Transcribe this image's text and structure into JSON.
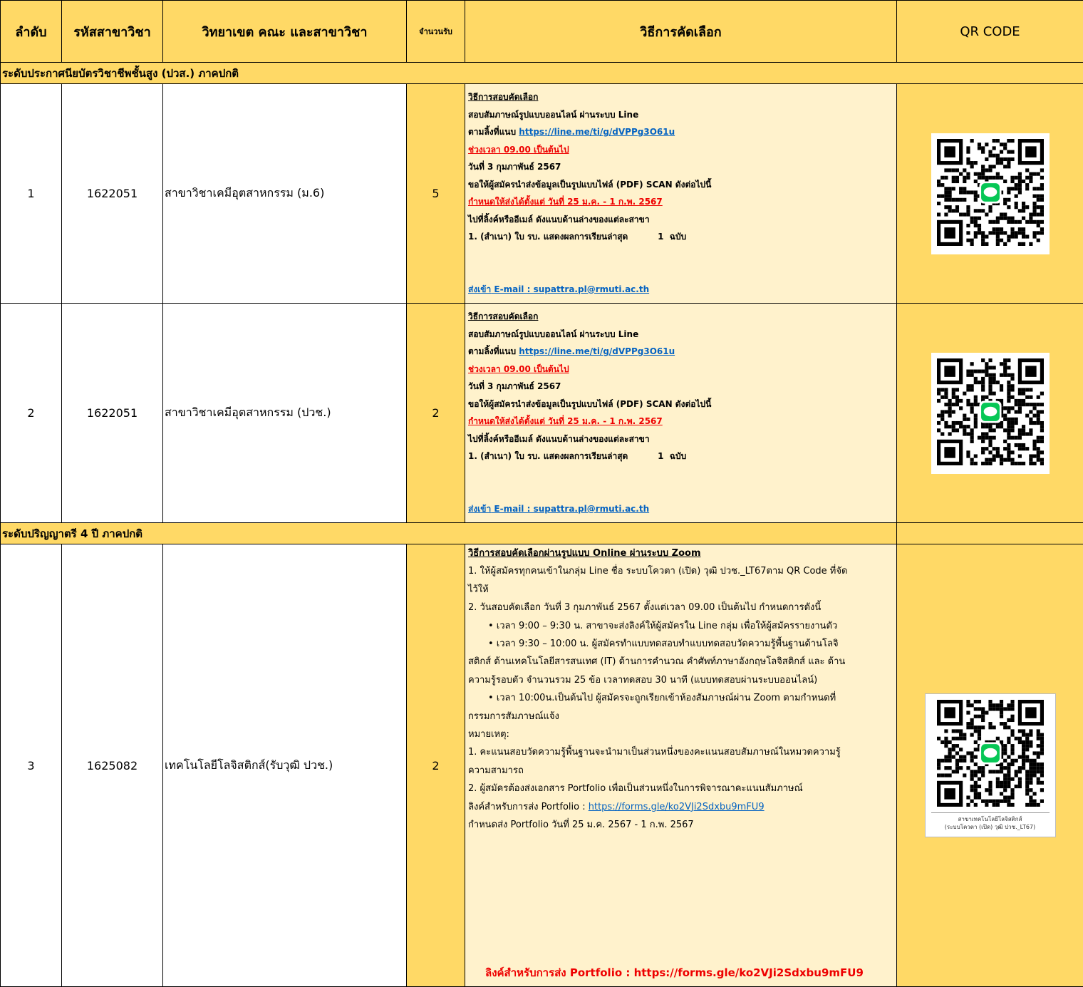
{
  "headers": {
    "order": "ลำดับ",
    "code": "รหัสสาขาวิชา",
    "faculty": "วิทยาเขต คณะ และสาขาวิชา",
    "seats": "จำนวนรับ",
    "method": "วิธีการคัดเลือก",
    "qr": "QR CODE"
  },
  "section1": "ระดับประกาศนียบัตรวิชาชีพชั้นสูง (ปวส.) ภาคปกติ",
  "section2": "ระดับปริญญาตรี 4 ปี ภาคปกติ",
  "rows": [
    {
      "order": "1",
      "code": "1622051",
      "name": "สาขาวิชาเคมีอุตสาหกรรม  (ม.6)",
      "seats": "5"
    },
    {
      "order": "2",
      "code": "1622051",
      "name": "สาขาวิชาเคมีอุตสาหกรรม  (ปวช.)",
      "seats": "2"
    },
    {
      "order": "3",
      "code": "1625082",
      "name": "เทคโนโลยีโลจิสติกส์(รับวุฒิ ปวช.)",
      "seats": "2"
    }
  ],
  "methodA": {
    "heading": "วิธีการสอบคัดเลือก",
    "l1": "สอบสัมภาษณ์รูปแบบออนไลน์ ผ่านระบบ Line",
    "l2prefix": "ตามลิ้งที่แนบ ",
    "link": "https://line.me/ti/g/dVPPg3O61u",
    "time": "ช่วงเวลา 09.00 เป็นต้นไป",
    "date": "วันที่ 3 กุมภาพันธ์ 2567",
    "submit": "ขอให้ผู้สมัครนำส่งข้อมูลเป็นรูปแบบไฟล์ (PDF) SCAN ดังต่อไปนี้",
    "deadline": "กำหนดให้ส่งได้ตั้งแต่ วันที่ 25 ม.ค. - 1 ก.พ. 2567",
    "go": "ไปที่ลิ้งค์หรืออีเมล์ ดังแนบด้านล่างของแต่ละสาขา",
    "doc": "1. (สำเนา) ใบ รบ. แสดงผลการเรียนล่าสุด          1  ฉบับ",
    "emailPrefix": "ส่งเข้า",
    "email": " E-mail : supattra.pl@rmuti.ac.th"
  },
  "methodB": {
    "heading": "วิธีการสอบคัดเลือกผ่านรูปแบบ Online ผ่านระบบ Zoom",
    "l1": "1. ให้ผู้สมัครทุกคนเข้าในกลุ่ม Line ชื่อ ระบบโควตา (เปิด) วุฒิ ปวช._LT67ตาม QR Code ที่จัด",
    "l1b": "ไว้ให้",
    "l2": "2. วันสอบคัดเลือก วันที่ 3 กุมภาพันธ์ 2567 ตั้งแต่เวลา 09.00 เป็นต้นไป กำหนดการดังนี้",
    "b1": "• เวลา 9:00 – 9:30 น. สาขาจะส่งลิงค์ให้ผู้สมัครใน Line กลุ่ม เพื่อให้ผู้สมัครรายงานตัว",
    "b2": "• เวลา 9:30 – 10:00 น. ผู้สมัครทำแบบทดสอบทำแบบทดสอบวัดความรู้พื้นฐานด้านโลจิ",
    "b2b": "สติกส์ ด้านเทคโนโลยีสารสนเทศ (IT) ด้านการคำนวณ คำศัพท์ภาษาอังกฤษโลจิสติกส์ และ ด้าน",
    "b2c": "ความรู้รอบตัว จำนวนรวม 25 ข้อ เวลาทดสอบ 30 นาที (แบบทดสอบผ่านระบบออนไลน์)",
    "b3": "• เวลา 10:00น.เป็นต้นไป ผู้สมัครจะถูกเรียกเข้าห้องสัมภาษณ์ผ่าน Zoom ตามกำหนดที่",
    "b3b": "กรรมการสัมภาษณ์แจ้ง",
    "note": "หมายเหตุ:",
    "n1": "1.  คะแนนสอบวัดความรู้พื้นฐานจะนำมาเป็นส่วนหนึ่งของคะแนนสอบสัมภาษณ์ในหมวดความรู้",
    "n1b": "ความสามารถ",
    "n2": "2.  ผู้สมัครต้องส่งเอกสาร Portfolio  เพื่อเป็นส่วนหนึ่งในการพิจารณาคะแนนสัมภาษณ์",
    "linkPrefix": "ลิงค์สำหรับการส่ง  Portfolio : ",
    "link": "https://forms.gle/ko2VJi2Sdxbu9mFU9",
    "due": "กำหนดส่ง Portfolio วันที่ 25 ม.ค. 2567 - 1 ก.พ. 2567",
    "bottom": "ลิงค์สำหรับการส่ง Portfolio : https://forms.gle/ko2VJi2Sdxbu9mFU9"
  },
  "qrCaption": {
    "l1": "สาขาเทคโนโลยีโลจิสติกส์",
    "l2": "(ระบบโควตา (เปิด) วุฒิ ปวช._LT67)"
  },
  "colors": {
    "header": "#ffd966",
    "method": "#fff2cc",
    "link": "#0563c1",
    "red": "#e00000",
    "line": "#06c755"
  },
  "icons": {
    "qr": "qr-code-icon",
    "line": "line-logo-icon"
  }
}
